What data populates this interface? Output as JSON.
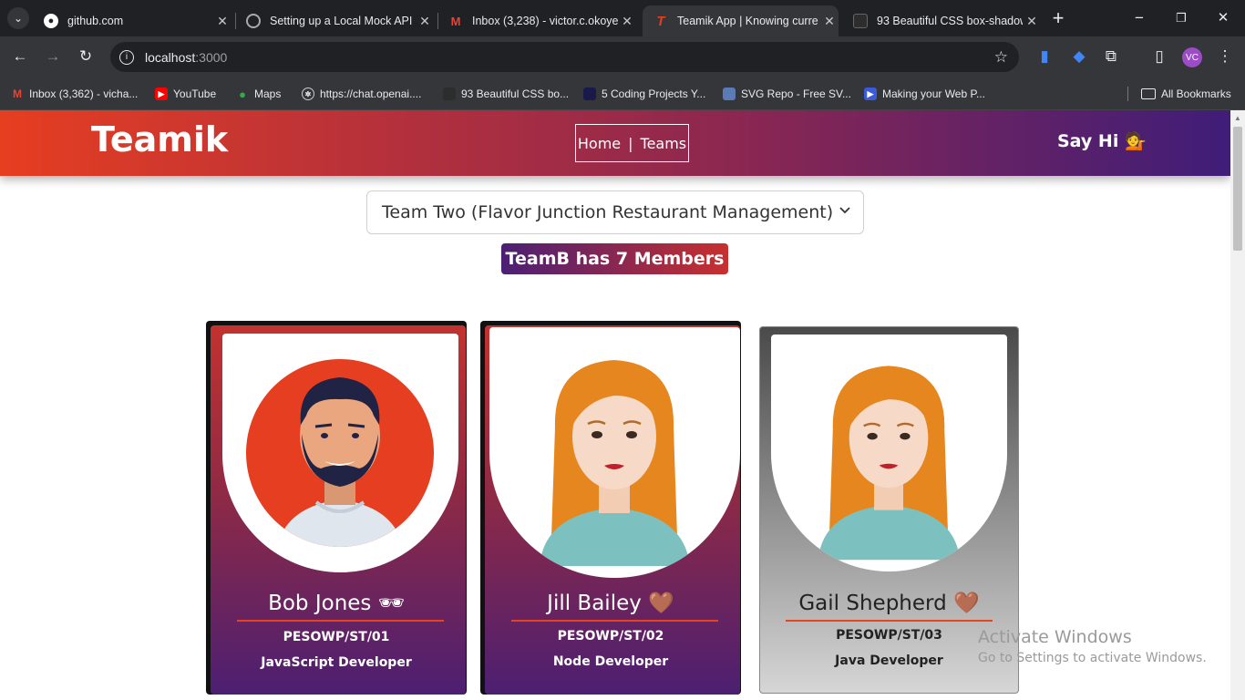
{
  "browser": {
    "tabs": [
      {
        "title": "github.com",
        "icon": "github-icon"
      },
      {
        "title": "Setting up a Local Mock API",
        "icon": "web-icon"
      },
      {
        "title": "Inbox (3,238) - victor.c.okoye",
        "icon": "gmail-icon"
      },
      {
        "title": "Teamik App | Knowing curre",
        "icon": "teamik-icon"
      },
      {
        "title": "93 Beautiful CSS box-shadow",
        "icon": "web-icon"
      }
    ],
    "address": {
      "host": "localhost",
      "port": ":3000"
    },
    "profile_initials": "VC",
    "bookmarks": [
      {
        "label": "Inbox (3,362) - vicha...",
        "icon": "gmail-icon"
      },
      {
        "label": "YouTube",
        "icon": "youtube-icon"
      },
      {
        "label": "Maps",
        "icon": "maps-icon"
      },
      {
        "label": "https://chat.openai....",
        "icon": "openai-icon"
      },
      {
        "label": "93 Beautiful CSS bo...",
        "icon": "web-icon"
      },
      {
        "label": "5 Coding Projects Y...",
        "icon": "web-icon"
      },
      {
        "label": "SVG Repo - Free SV...",
        "icon": "web-icon"
      },
      {
        "label": "Making your Web P...",
        "icon": "web-icon"
      }
    ],
    "all_bookmarks": "All Bookmarks"
  },
  "app": {
    "logo": "Teamik",
    "nav": {
      "home": "Home",
      "separator": "|",
      "teams": "Teams"
    },
    "say_hi": "Say Hi 💁",
    "team_select": {
      "selected": "Team Two (Flavor Junction Restaurant Management)"
    },
    "member_count": "TeamB has 7 Members",
    "members": [
      {
        "name": "Bob Jones 🕶",
        "id": "PESOWP/ST/01",
        "role": "JavaScript Developer",
        "avatar": "male-avatar",
        "selected": false
      },
      {
        "name": "Jill Bailey 🤎",
        "id": "PESOWP/ST/02",
        "role": "Node Developer",
        "avatar": "female-avatar",
        "selected": false
      },
      {
        "name": "Gail Shepherd 🤎",
        "id": "PESOWP/ST/03",
        "role": "Java Developer",
        "avatar": "female-avatar",
        "selected": true
      }
    ]
  },
  "watermark": {
    "title": "Activate Windows",
    "subtitle": "Go to Settings to activate Windows."
  },
  "colors": {
    "header_start": "#e63e21",
    "header_end": "#3f1d78",
    "accent_rule": "#e8431d"
  }
}
